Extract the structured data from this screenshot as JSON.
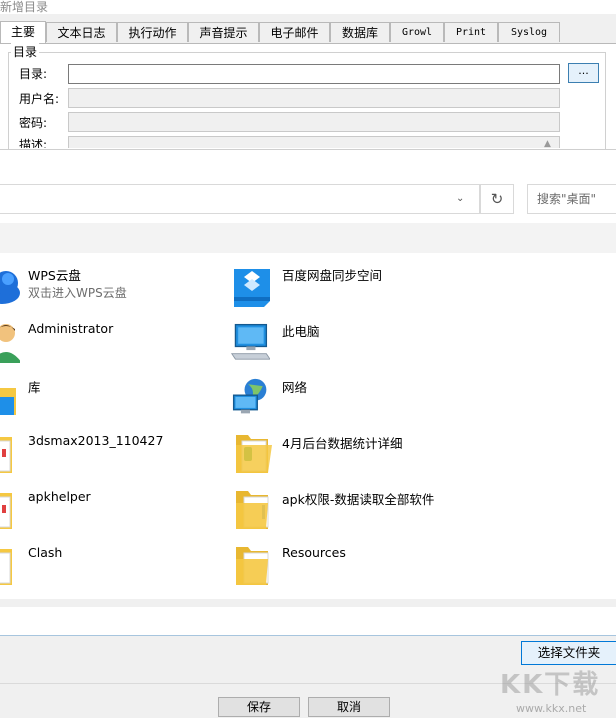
{
  "back_dialog": {
    "title": "新增目录",
    "tabs": [
      {
        "label": "主要",
        "active": true
      },
      {
        "label": "文本日志"
      },
      {
        "label": "执行动作"
      },
      {
        "label": "声音提示"
      },
      {
        "label": "电子邮件"
      },
      {
        "label": "数据库"
      },
      {
        "label": "Growl"
      },
      {
        "label": "Print"
      },
      {
        "label": "Syslog"
      }
    ],
    "group_label": "目录",
    "fields": {
      "directory_label": "目录:",
      "username_label": "用户名:",
      "password_label": "密码:",
      "description_label": "描述:"
    },
    "browse_label": "...",
    "save_label": "保存",
    "cancel_label": "取消"
  },
  "picker": {
    "search_placeholder": "搜索\"桌面\"",
    "refresh_icon": "refresh-icon",
    "items": [
      {
        "name": "WPS云盘",
        "sub": "双击进入WPS云盘",
        "icon": "cloud-icon"
      },
      {
        "name": "百度网盘同步空间",
        "icon": "baidu-netdisk-icon"
      },
      {
        "name": "Administrator",
        "icon": "user-icon"
      },
      {
        "name": "此电脑",
        "icon": "computer-icon"
      },
      {
        "name": "库",
        "icon": "library-icon"
      },
      {
        "name": "网络",
        "icon": "network-icon"
      },
      {
        "name": "3dsmax2013_110427",
        "icon": "folder-icon"
      },
      {
        "name": "4月后台数据统计详细",
        "icon": "folder-icon"
      },
      {
        "name": "apkhelper",
        "icon": "folder-icon"
      },
      {
        "name": "apk权限-数据读取全部软件",
        "icon": "folder-icon"
      },
      {
        "name": "Clash",
        "icon": "folder-icon"
      },
      {
        "name": "Resources",
        "icon": "folder-icon"
      }
    ],
    "select_folder_label": "选择文件夹"
  },
  "watermark": {
    "main": "KK下载",
    "sub": "www.kkx.net"
  },
  "colors": {
    "accent": "#0078d7",
    "folder": "#f5c842",
    "cloud": "#1e6fd9"
  }
}
